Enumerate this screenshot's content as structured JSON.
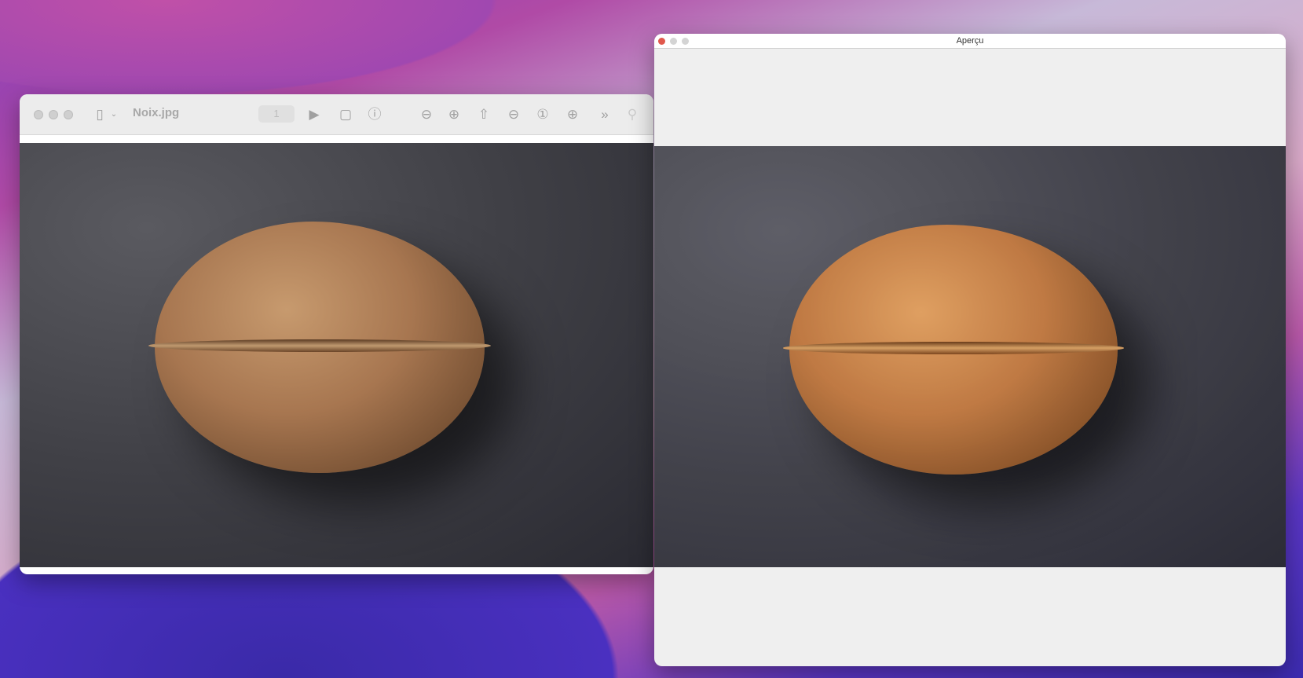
{
  "preview_window": {
    "title": "Noix.jpg",
    "page_number": "1",
    "toolbar_icons": [
      "sidebar-icon",
      "chevron-down-icon",
      "slideshow-icon",
      "rotate-icon",
      "info-icon",
      "zoom-out-icon",
      "zoom-in-icon",
      "share-icon",
      "zoom-out-icon",
      "actual-size-icon",
      "zoom-in-icon",
      "more-icon",
      "search-icon"
    ]
  },
  "apercu_window": {
    "title": "Aperçu"
  },
  "colors": {
    "close_red": "#e0584c",
    "traffic_gray": "#cfcfcf",
    "toolbar_bg": "#ececec",
    "preview_bg": "#efefef"
  }
}
